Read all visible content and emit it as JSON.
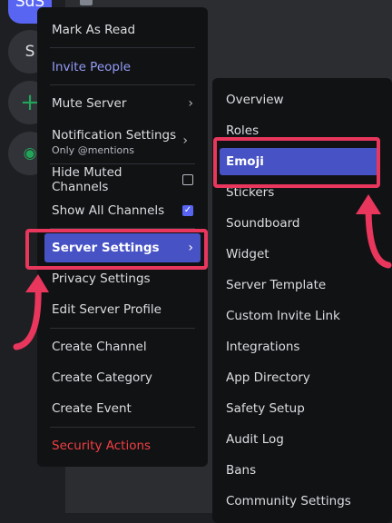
{
  "servers": [
    {
      "label": "SdS"
    },
    {
      "label": "S"
    },
    {
      "label": "+"
    },
    {
      "label": "◉"
    }
  ],
  "context_menu": {
    "items": [
      {
        "label": "Mark As Read"
      },
      {
        "label": "Invite People"
      },
      {
        "label": "Mute Server"
      },
      {
        "label": "Notification Settings",
        "sub": "Only @mentions"
      },
      {
        "label": "Hide Muted Channels",
        "checked": false
      },
      {
        "label": "Show All Channels",
        "checked": true
      },
      {
        "label": "Server Settings"
      },
      {
        "label": "Privacy Settings"
      },
      {
        "label": "Edit Server Profile"
      },
      {
        "label": "Create Channel"
      },
      {
        "label": "Create Category"
      },
      {
        "label": "Create Event"
      },
      {
        "label": "Security Actions"
      }
    ]
  },
  "submenu": {
    "items": [
      {
        "label": "Overview"
      },
      {
        "label": "Roles"
      },
      {
        "label": "Emoji"
      },
      {
        "label": "Stickers"
      },
      {
        "label": "Soundboard"
      },
      {
        "label": "Widget"
      },
      {
        "label": "Server Template"
      },
      {
        "label": "Custom Invite Link"
      },
      {
        "label": "Integrations"
      },
      {
        "label": "App Directory"
      },
      {
        "label": "Safety Setup"
      },
      {
        "label": "Audit Log"
      },
      {
        "label": "Bans"
      },
      {
        "label": "Community Settings"
      }
    ]
  },
  "colors": {
    "accent": "#5865f2",
    "selected": "#4752c4",
    "annotation": "#e8365d",
    "danger": "#f23f43",
    "link": "#949cf7"
  }
}
